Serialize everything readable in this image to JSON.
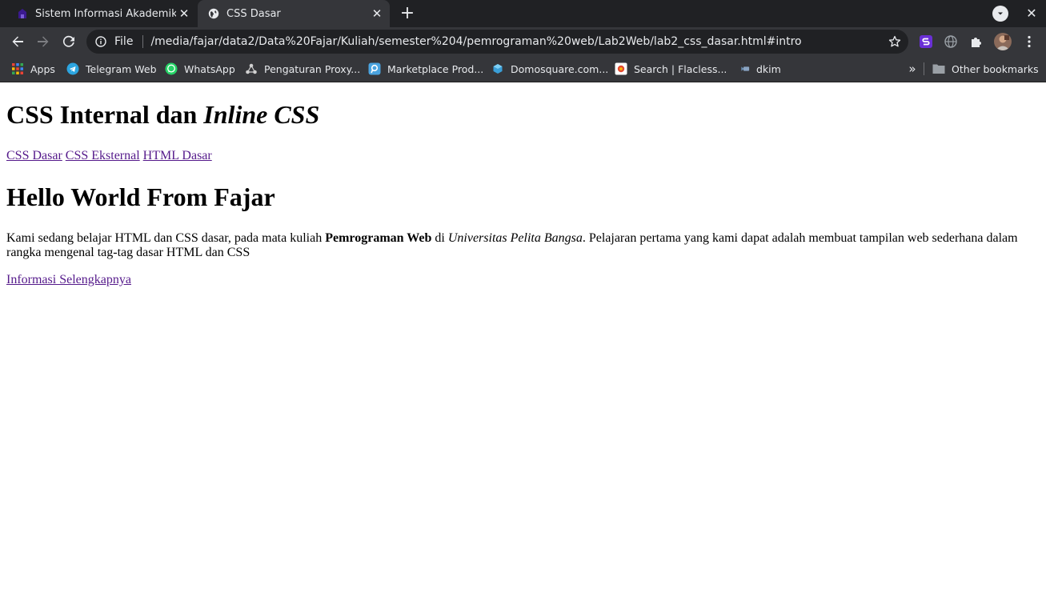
{
  "browser": {
    "tabs": [
      {
        "title": "Sistem Informasi Akademik",
        "active": false
      },
      {
        "title": "CSS Dasar",
        "active": true
      }
    ],
    "omnibox": {
      "scheme_label": "File",
      "url": "/media/fajar/data2/Data%20Fajar/Kuliah/semester%204/pemrograman%20web/Lab2Web/lab2_css_dasar.html#intro"
    },
    "bookmarks": [
      {
        "label": "Apps",
        "icon": "apps-grid-icon"
      },
      {
        "label": "Telegram Web",
        "icon": "telegram-icon"
      },
      {
        "label": "WhatsApp",
        "icon": "whatsapp-icon"
      },
      {
        "label": "Pengaturan Proxy...",
        "icon": "proxy-icon"
      },
      {
        "label": "Marketplace Prod...",
        "icon": "marketplace-icon"
      },
      {
        "label": "Domosquare.com...",
        "icon": "domosquare-icon"
      },
      {
        "label": "Search | Flacless...",
        "icon": "flacless-icon"
      },
      {
        "label": "dkim",
        "icon": "dkim-icon"
      }
    ],
    "other_bookmarks": "Other bookmarks"
  },
  "page": {
    "heading_plain": "CSS Internal dan ",
    "heading_italic": "Inline CSS",
    "nav_links": [
      "CSS Dasar",
      "CSS Eksternal",
      "HTML Dasar"
    ],
    "hello_heading": "Hello World From Fajar",
    "paragraph": {
      "part1": "Kami sedang belajar HTML dan CSS dasar, pada mata kuliah ",
      "bold": "Pemrograman Web",
      "part2": " di ",
      "italic": "Universitas Pelita Bangsa",
      "part3": ". Pelajaran pertama yang kami dapat adalah membuat tampilan web sederhana dalam rangka mengenal tag-tag dasar HTML dan CSS"
    },
    "more_link": "Informasi Selengkapnya"
  },
  "colors": {
    "tabstrip_bg": "#202124",
    "toolbar_bg": "#35363a",
    "visited_link": "#551a8b"
  }
}
